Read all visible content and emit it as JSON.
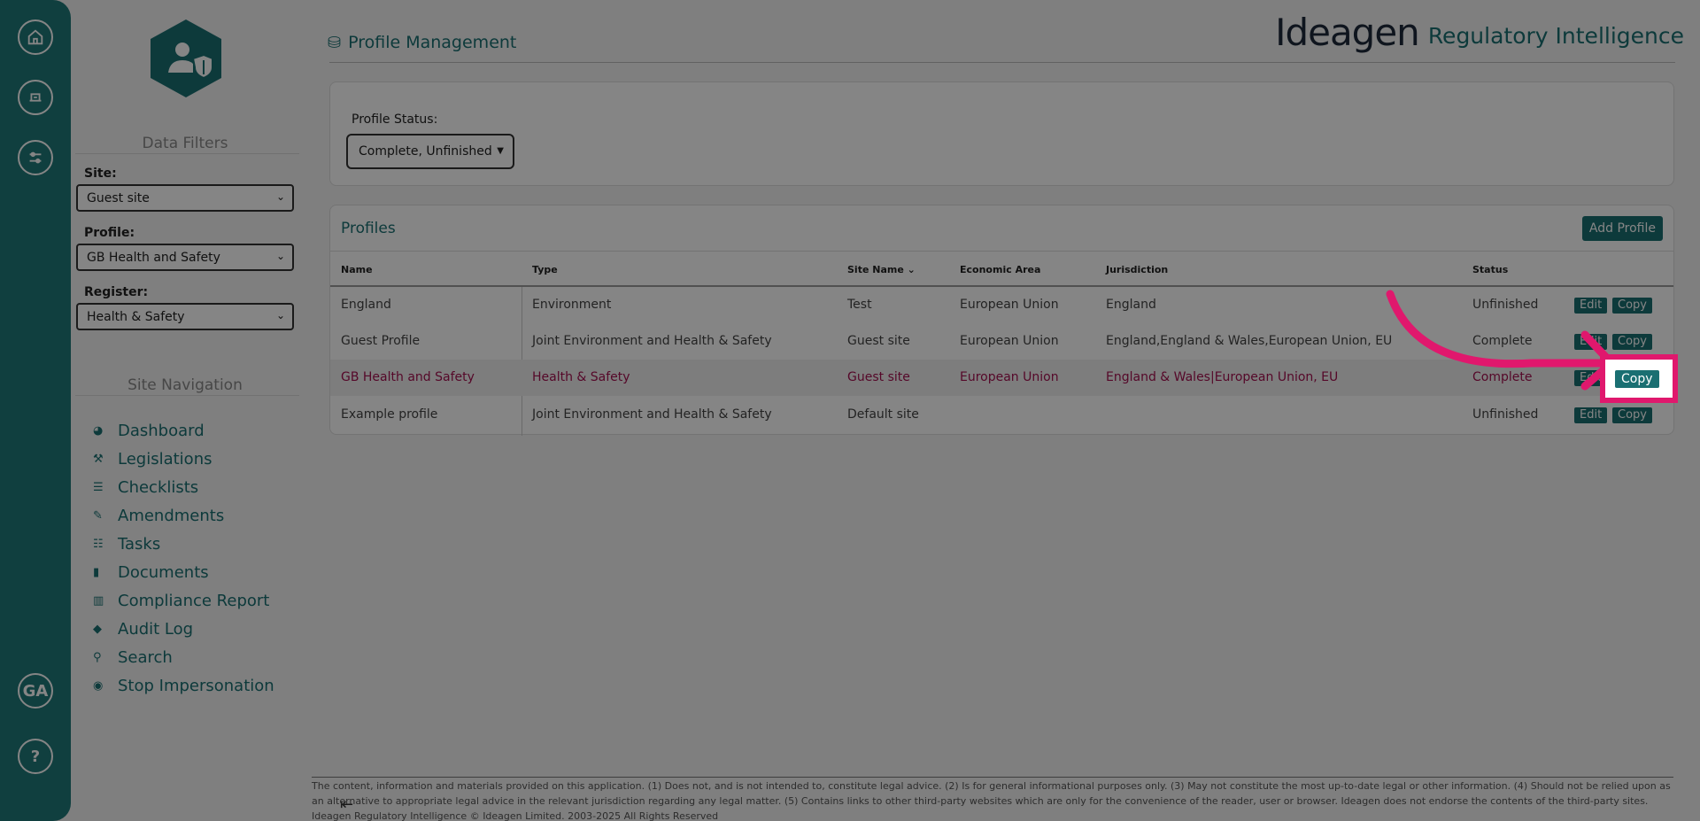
{
  "rail": {
    "initials": "GA",
    "help": "?"
  },
  "filters": {
    "title": "Data Filters",
    "site_label": "Site:",
    "site_value": "Guest site",
    "profile_label": "Profile:",
    "profile_value": "GB Health and Safety",
    "register_label": "Register:",
    "register_value": "Health & Safety"
  },
  "navigation": {
    "title": "Site Navigation",
    "items": [
      {
        "label": "Dashboard",
        "icon": "dashboard-icon"
      },
      {
        "label": "Legislations",
        "icon": "gavel-icon"
      },
      {
        "label": "Checklists",
        "icon": "list-icon"
      },
      {
        "label": "Amendments",
        "icon": "edit-icon"
      },
      {
        "label": "Tasks",
        "icon": "tasks-icon"
      },
      {
        "label": "Documents",
        "icon": "file-icon"
      },
      {
        "label": "Compliance Report",
        "icon": "bar-chart-icon"
      },
      {
        "label": "Audit Log",
        "icon": "tags-icon"
      },
      {
        "label": "Search",
        "icon": "search-icon"
      },
      {
        "label": "Stop Impersonation",
        "icon": "stop-icon"
      }
    ]
  },
  "header": {
    "page_title": "Profile Management",
    "brand_name": "Ideagen",
    "brand_product": "Regulatory Intelligence"
  },
  "status_filter": {
    "label": "Profile Status:",
    "value": "Complete, Unfinished"
  },
  "profiles": {
    "title": "Profiles",
    "add_label": "Add Profile",
    "columns": [
      "Name",
      "Type",
      "Site Name",
      "Economic Area",
      "Jurisdiction",
      "Status"
    ],
    "rows": [
      {
        "name": "England",
        "type": "Environment",
        "site": "Test",
        "area": "European Union",
        "jurisdiction": "England",
        "status": "Unfinished"
      },
      {
        "name": "Guest Profile",
        "type": "Joint Environment and Health & Safety",
        "site": "Guest site",
        "area": "European Union",
        "jurisdiction": "England,England & Wales,European Union, EU",
        "status": "Complete"
      },
      {
        "name": "GB Health and Safety",
        "type": "Health & Safety",
        "site": "Guest site",
        "area": "European Union",
        "jurisdiction": "England & Wales|European Union, EU",
        "status": "Complete"
      },
      {
        "name": "Example profile",
        "type": "Joint Environment and Health & Safety",
        "site": "Default site",
        "area": "",
        "jurisdiction": "",
        "status": "Unfinished"
      }
    ],
    "edit_label": "Edit",
    "copy_label": "Copy"
  },
  "footer": {
    "line1": "The content, information and materials provided on this application. (1) Does not, and is not intended to, constitute legal advice. (2) Is for general informational purposes only. (3) May not constitute the most up-to-date legal or other information. (4) Should not be relied upon as",
    "line2": "an alternative to appropriate legal advice in the relevant jurisdiction regarding any legal matter. (5) Contains links to other third-party websites which are only for the convenience of the reader, user or browser. Ideagen does not endorse the contents of the third-party sites.",
    "line3": "Ideagen Regulatory Intelligence © Ideagen Limited. 2003-2025 All Rights Reserved"
  },
  "colors": {
    "accent": "#1a6f72",
    "highlight": "#e0186d",
    "selected_text": "#a4104f"
  }
}
